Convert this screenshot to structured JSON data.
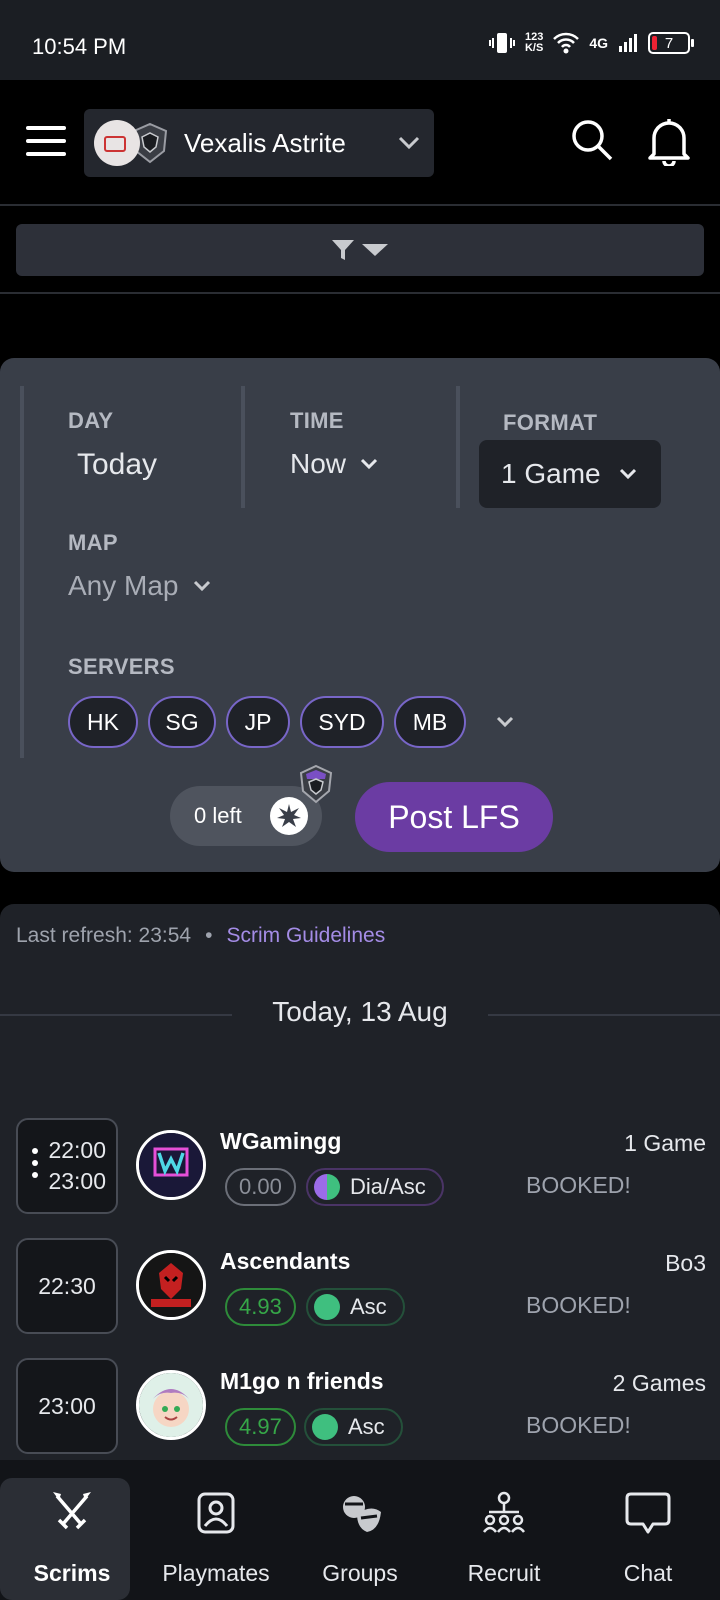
{
  "status": {
    "time": "10:54 PM",
    "net_speed_top": "123",
    "net_speed_bottom": "K/S",
    "network": "4G",
    "battery": "7"
  },
  "header": {
    "team_name": "Vexalis Astrite"
  },
  "form": {
    "day_label": "DAY",
    "day_value": "Today",
    "time_label": "TIME",
    "time_value": "Now",
    "format_label": "FORMAT",
    "format_value": "1 Game",
    "map_label": "MAP",
    "map_value": "Any Map",
    "servers_label": "SERVERS",
    "servers": [
      "HK",
      "SG",
      "JP",
      "SYD",
      "MB"
    ],
    "credits": "0 left",
    "post_button": "Post LFS"
  },
  "list": {
    "refresh": "Last refresh: 23:54",
    "separator": "•",
    "guidelines": "Scrim Guidelines",
    "date_header": "Today, 13 Aug",
    "matches": [
      {
        "time_start": "22:00",
        "time_end": "23:00",
        "team": "WGamingg",
        "rating": "0.00",
        "rank": "Dia/Asc",
        "format": "1 Game",
        "status": "BOOKED!"
      },
      {
        "time": "22:30",
        "team": "Ascendants",
        "rating": "4.93",
        "rank": "Asc",
        "format": "Bo3",
        "status": "BOOKED!"
      },
      {
        "time": "23:00",
        "team": "M1go n friends",
        "rating": "4.97",
        "rank": "Asc",
        "format": "2 Games",
        "status": "BOOKED!"
      }
    ]
  },
  "nav": {
    "items": [
      {
        "label": "Scrims",
        "icon": "crossed-swords-icon",
        "active": true
      },
      {
        "label": "Playmates",
        "icon": "playmates-icon",
        "active": false
      },
      {
        "label": "Groups",
        "icon": "groups-icon",
        "active": false
      },
      {
        "label": "Recruit",
        "icon": "recruit-icon",
        "active": false
      },
      {
        "label": "Chat",
        "icon": "chat-icon",
        "active": false
      }
    ]
  },
  "colors": {
    "accent": "#6b3ca3",
    "link": "#a48ce6",
    "good_rating": "#36a748",
    "asc_rank": "#3fbf7f",
    "dia_rank": "#9b6ce8"
  }
}
